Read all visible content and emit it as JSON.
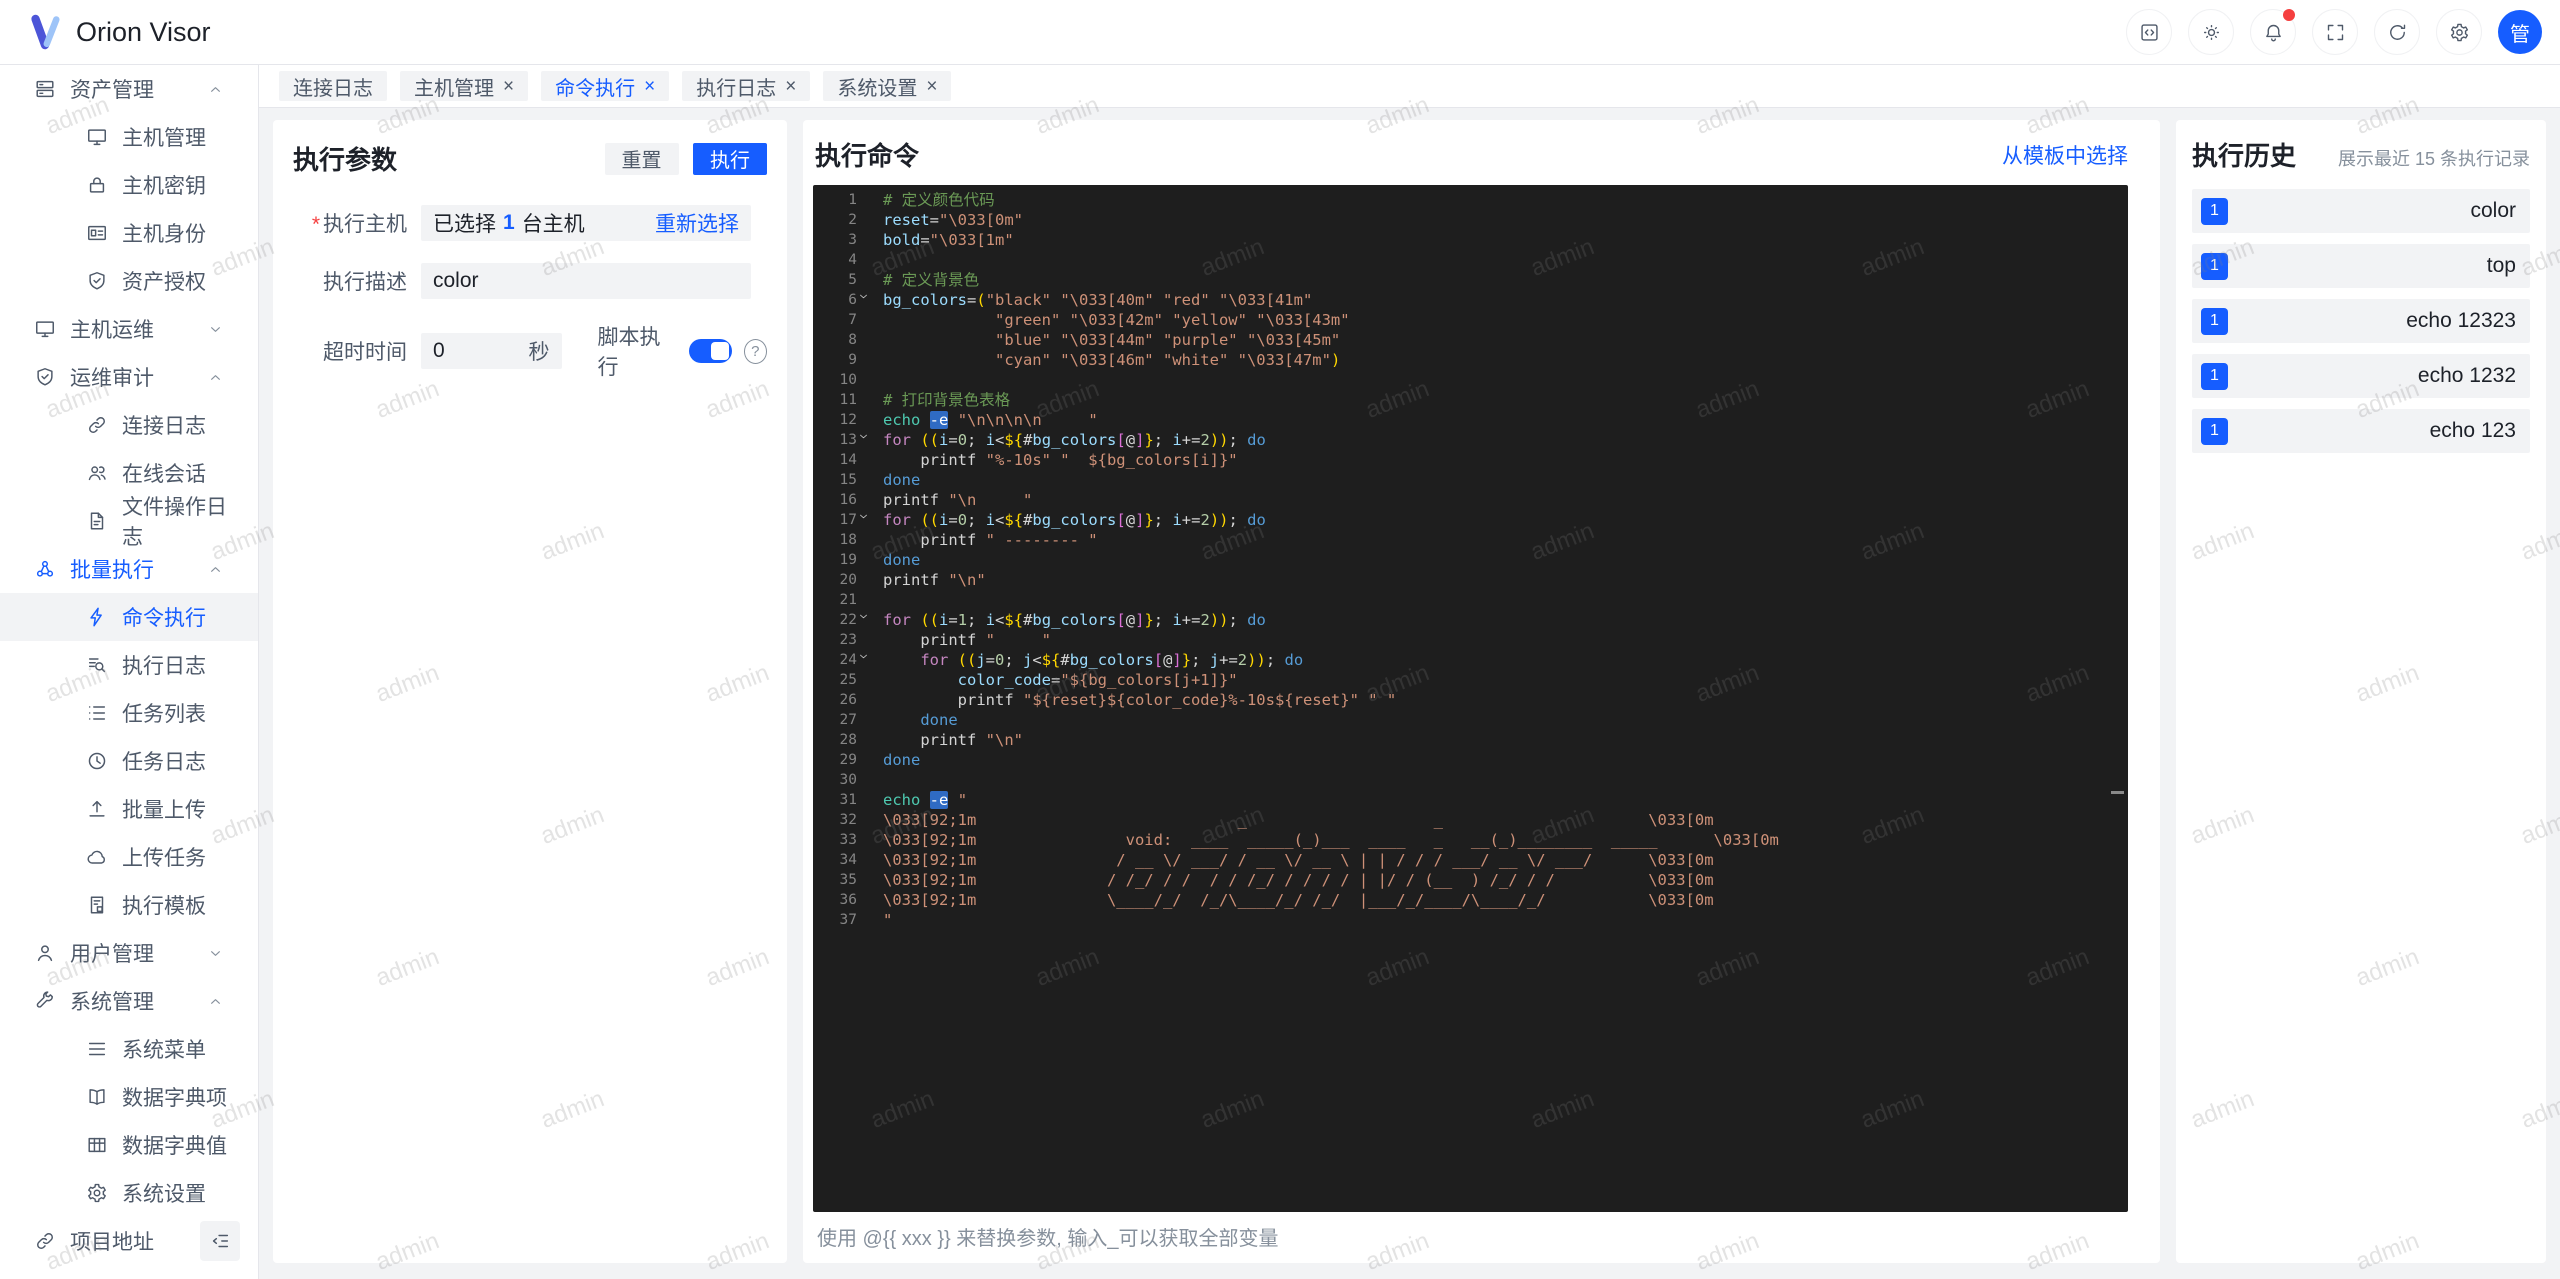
{
  "watermark": {
    "text": "admin"
  },
  "header": {
    "logo_text": "Orion Visor",
    "actions": [
      {
        "id": "code",
        "icon": "codebox"
      },
      {
        "id": "theme",
        "icon": "sun"
      },
      {
        "id": "notifications",
        "icon": "bell",
        "badge": true
      },
      {
        "id": "fullscreen",
        "icon": "fullscreen"
      },
      {
        "id": "refresh",
        "icon": "refresh"
      },
      {
        "id": "settings",
        "icon": "gear"
      }
    ],
    "avatar_text": "管"
  },
  "tabs": [
    {
      "id": "connection-log",
      "label": "连接日志",
      "closable": false,
      "active": false
    },
    {
      "id": "host-management",
      "label": "主机管理",
      "closable": true,
      "active": false
    },
    {
      "id": "command-execution",
      "label": "命令执行",
      "closable": true,
      "active": true
    },
    {
      "id": "execution-log",
      "label": "执行日志",
      "closable": true,
      "active": false
    },
    {
      "id": "system-settings",
      "label": "系统设置",
      "closable": true,
      "active": false
    }
  ],
  "sidebar": {
    "items": [
      {
        "id": "asset-management",
        "label": "资产管理",
        "icon": "server",
        "lvl": 1,
        "chev": "up"
      },
      {
        "id": "host-management",
        "label": "主机管理",
        "icon": "monitor",
        "lvl": 2
      },
      {
        "id": "host-keys",
        "label": "主机密钥",
        "icon": "lock",
        "lvl": 2
      },
      {
        "id": "host-identity",
        "label": "主机身份",
        "icon": "idcard",
        "lvl": 2
      },
      {
        "id": "asset-authorization",
        "label": "资产授权",
        "icon": "shield",
        "lvl": 2
      },
      {
        "id": "host-ops",
        "label": "主机运维",
        "icon": "monitor",
        "lvl": 1,
        "chev": "down"
      },
      {
        "id": "ops-audit",
        "label": "运维审计",
        "icon": "shield",
        "lvl": 1,
        "chev": "up"
      },
      {
        "id": "connection-log",
        "label": "连接日志",
        "icon": "link",
        "lvl": 2
      },
      {
        "id": "online-sessions",
        "label": "在线会话",
        "icon": "users",
        "lvl": 2
      },
      {
        "id": "file-operation-log",
        "label": "文件操作日志",
        "icon": "file",
        "lvl": 2
      },
      {
        "id": "batch-execution",
        "label": "批量执行",
        "icon": "cluster",
        "lvl": 1,
        "chev": "up",
        "active": true
      },
      {
        "id": "command-execution",
        "label": "命令执行",
        "icon": "bolt",
        "lvl": 2,
        "selected": true
      },
      {
        "id": "execution-log",
        "label": "执行日志",
        "icon": "filesearch",
        "lvl": 2
      },
      {
        "id": "task-list",
        "label": "任务列表",
        "icon": "list",
        "lvl": 2
      },
      {
        "id": "task-log",
        "label": "任务日志",
        "icon": "clock",
        "lvl": 2
      },
      {
        "id": "batch-upload",
        "label": "批量上传",
        "icon": "upload",
        "lvl": 2
      },
      {
        "id": "upload-tasks",
        "label": "上传任务",
        "icon": "cloud",
        "lvl": 2
      },
      {
        "id": "execution-templates",
        "label": "执行模板",
        "icon": "template",
        "lvl": 2
      },
      {
        "id": "user-management",
        "label": "用户管理",
        "icon": "user",
        "lvl": 1,
        "chev": "down"
      },
      {
        "id": "system-management",
        "label": "系统管理",
        "icon": "wrench",
        "lvl": 1,
        "chev": "up"
      },
      {
        "id": "system-menu",
        "label": "系统菜单",
        "icon": "menu",
        "lvl": 2
      },
      {
        "id": "dict-keys",
        "label": "数据字典项",
        "icon": "book",
        "lvl": 2
      },
      {
        "id": "dict-values",
        "label": "数据字典值",
        "icon": "table",
        "lvl": 2
      },
      {
        "id": "system-settings",
        "label": "系统设置",
        "icon": "gear",
        "lvl": 2
      },
      {
        "id": "project-url",
        "label": "项目地址",
        "icon": "link",
        "lvl": 1
      }
    ]
  },
  "params_panel": {
    "title": "执行参数",
    "reset_label": "重置",
    "run_label": "执行",
    "host_label": "执行主机",
    "host_prefix": "已选择",
    "host_count": "1",
    "host_suffix": "台主机",
    "reselect_label": "重新选择",
    "desc_label": "执行描述",
    "desc_value": "color",
    "timeout_label": "超时时间",
    "timeout_value": "0",
    "timeout_unit": "秒",
    "script_label": "脚本执行",
    "script_on": true
  },
  "command_panel": {
    "title": "执行命令",
    "template_link": "从模板中选择",
    "hint": "使用 @{{ xxx }} 来替换参数, 输入_可以获取全部变量",
    "code_lines": [
      {
        "t": [
          [
            "c",
            "# 定义颜色代码"
          ]
        ]
      },
      {
        "t": [
          [
            "v",
            "reset"
          ],
          [
            "w",
            "="
          ],
          [
            "s",
            "\"\\033[0m\""
          ]
        ]
      },
      {
        "t": [
          [
            "v",
            "bold"
          ],
          [
            "w",
            "="
          ],
          [
            "s",
            "\"\\033[1m\""
          ]
        ]
      },
      {
        "t": []
      },
      {
        "t": [
          [
            "c",
            "# 定义背景色"
          ]
        ]
      },
      {
        "f": 1,
        "t": [
          [
            "v",
            "bg_colors"
          ],
          [
            "w",
            "="
          ],
          [
            "g",
            "("
          ],
          [
            "s",
            "\"black\" \"\\033[40m\" \"red\" \"\\033[41m\""
          ]
        ]
      },
      {
        "t": [
          [
            "w",
            "            "
          ],
          [
            "s",
            "\"green\" \"\\033[42m\" \"yellow\" \"\\033[43m\""
          ]
        ]
      },
      {
        "t": [
          [
            "w",
            "            "
          ],
          [
            "s",
            "\"blue\" \"\\033[44m\" \"purple\" \"\\033[45m\""
          ]
        ]
      },
      {
        "t": [
          [
            "w",
            "            "
          ],
          [
            "s",
            "\"cyan\" \"\\033[46m\" \"white\" \"\\033[47m\""
          ],
          [
            "g",
            ")"
          ]
        ]
      },
      {
        "t": []
      },
      {
        "t": [
          [
            "c",
            "# 打印背景色表格"
          ]
        ]
      },
      {
        "t": [
          [
            "f2",
            "echo "
          ],
          [
            "hl",
            "-e"
          ],
          [
            "w",
            " "
          ],
          [
            "s",
            "\"\\n\\n\\n\\n     \""
          ]
        ]
      },
      {
        "f": 1,
        "t": [
          [
            "k",
            "for "
          ],
          [
            "g",
            "(("
          ],
          [
            "v",
            "i"
          ],
          [
            "w",
            "="
          ],
          [
            "n",
            "0"
          ],
          [
            "w",
            "; "
          ],
          [
            "v",
            "i"
          ],
          [
            "w",
            "<"
          ],
          [
            "g",
            "${"
          ],
          [
            "w",
            "#"
          ],
          [
            "v",
            "bg_colors"
          ],
          [
            "m",
            "["
          ],
          [
            "w",
            "@"
          ],
          [
            "m",
            "]"
          ],
          [
            "g",
            "}"
          ],
          [
            "w",
            "; "
          ],
          [
            "v",
            "i"
          ],
          [
            "w",
            "+="
          ],
          [
            "n",
            "2"
          ],
          [
            "g",
            "))"
          ],
          [
            "w",
            "; "
          ],
          [
            "d",
            "do"
          ]
        ]
      },
      {
        "t": [
          [
            "w",
            "    "
          ],
          [
            "p",
            "printf "
          ],
          [
            "s",
            "\"%-10s\" \"  ${bg_colors[i]}\""
          ]
        ]
      },
      {
        "t": [
          [
            "d",
            "done"
          ]
        ]
      },
      {
        "t": [
          [
            "p",
            "printf "
          ],
          [
            "s",
            "\"\\n     \""
          ]
        ]
      },
      {
        "f": 1,
        "t": [
          [
            "k",
            "for "
          ],
          [
            "g",
            "(("
          ],
          [
            "v",
            "i"
          ],
          [
            "w",
            "="
          ],
          [
            "n",
            "0"
          ],
          [
            "w",
            "; "
          ],
          [
            "v",
            "i"
          ],
          [
            "w",
            "<"
          ],
          [
            "g",
            "${"
          ],
          [
            "w",
            "#"
          ],
          [
            "v",
            "bg_colors"
          ],
          [
            "m",
            "["
          ],
          [
            "w",
            "@"
          ],
          [
            "m",
            "]"
          ],
          [
            "g",
            "}"
          ],
          [
            "w",
            "; "
          ],
          [
            "v",
            "i"
          ],
          [
            "w",
            "+="
          ],
          [
            "n",
            "2"
          ],
          [
            "g",
            "))"
          ],
          [
            "w",
            "; "
          ],
          [
            "d",
            "do"
          ]
        ]
      },
      {
        "t": [
          [
            "w",
            "    "
          ],
          [
            "p",
            "printf "
          ],
          [
            "s",
            "\" -------- \""
          ]
        ]
      },
      {
        "t": [
          [
            "d",
            "done"
          ]
        ]
      },
      {
        "t": [
          [
            "p",
            "printf "
          ],
          [
            "s",
            "\"\\n\""
          ]
        ]
      },
      {
        "t": []
      },
      {
        "f": 1,
        "t": [
          [
            "k",
            "for "
          ],
          [
            "g",
            "(("
          ],
          [
            "v",
            "i"
          ],
          [
            "w",
            "="
          ],
          [
            "n",
            "1"
          ],
          [
            "w",
            "; "
          ],
          [
            "v",
            "i"
          ],
          [
            "w",
            "<"
          ],
          [
            "g",
            "${"
          ],
          [
            "w",
            "#"
          ],
          [
            "v",
            "bg_colors"
          ],
          [
            "m",
            "["
          ],
          [
            "w",
            "@"
          ],
          [
            "m",
            "]"
          ],
          [
            "g",
            "}"
          ],
          [
            "w",
            "; "
          ],
          [
            "v",
            "i"
          ],
          [
            "w",
            "+="
          ],
          [
            "n",
            "2"
          ],
          [
            "g",
            "))"
          ],
          [
            "w",
            "; "
          ],
          [
            "d",
            "do"
          ]
        ]
      },
      {
        "t": [
          [
            "w",
            "    "
          ],
          [
            "p",
            "printf "
          ],
          [
            "s",
            "\"     \""
          ]
        ]
      },
      {
        "f": 1,
        "t": [
          [
            "w",
            "    "
          ],
          [
            "k",
            "for "
          ],
          [
            "g",
            "(("
          ],
          [
            "v",
            "j"
          ],
          [
            "w",
            "="
          ],
          [
            "n",
            "0"
          ],
          [
            "w",
            "; "
          ],
          [
            "v",
            "j"
          ],
          [
            "w",
            "<"
          ],
          [
            "g",
            "${"
          ],
          [
            "w",
            "#"
          ],
          [
            "v",
            "bg_colors"
          ],
          [
            "m",
            "["
          ],
          [
            "w",
            "@"
          ],
          [
            "m",
            "]"
          ],
          [
            "g",
            "}"
          ],
          [
            "w",
            "; "
          ],
          [
            "v",
            "j"
          ],
          [
            "w",
            "+="
          ],
          [
            "n",
            "2"
          ],
          [
            "g",
            "))"
          ],
          [
            "w",
            "; "
          ],
          [
            "d",
            "do"
          ]
        ]
      },
      {
        "t": [
          [
            "w",
            "        "
          ],
          [
            "v",
            "color_code"
          ],
          [
            "w",
            "="
          ],
          [
            "s",
            "\"${bg_colors[j+1]}\""
          ]
        ]
      },
      {
        "t": [
          [
            "w",
            "        "
          ],
          [
            "p",
            "printf "
          ],
          [
            "s",
            "\"${reset}${color_code}%-10s${reset}\" \" \""
          ]
        ]
      },
      {
        "t": [
          [
            "w",
            "    "
          ],
          [
            "d",
            "done"
          ]
        ]
      },
      {
        "t": [
          [
            "w",
            "    "
          ],
          [
            "p",
            "printf "
          ],
          [
            "s",
            "\"\\n\""
          ]
        ]
      },
      {
        "t": [
          [
            "d",
            "done"
          ]
        ]
      },
      {
        "t": []
      },
      {
        "t": [
          [
            "f2",
            "echo "
          ],
          [
            "hl",
            "-e"
          ],
          [
            "w",
            " "
          ],
          [
            "s",
            "\""
          ]
        ]
      },
      {
        "t": [
          [
            "s",
            "\\033[92;1m                            _                    _                      \\033[0m"
          ]
        ]
      },
      {
        "t": [
          [
            "s",
            "\\033[92;1m                void:  ____  _____(_)___  ____   _   __(_)________  _____      \\033[0m"
          ]
        ]
      },
      {
        "t": [
          [
            "s",
            "\\033[92;1m               / __ \\/ ___/ / __ \\/ __ \\ | | / / / ___/ __ \\/ ___/      \\033[0m"
          ]
        ]
      },
      {
        "t": [
          [
            "s",
            "\\033[92;1m              / /_/ / /  / / /_/ / / / / | |/ / (__  ) /_/ / /          \\033[0m"
          ]
        ]
      },
      {
        "t": [
          [
            "s",
            "\\033[92;1m              \\____/_/  /_/\\____/_/ /_/  |___/_/____/\\____/_/           \\033[0m"
          ]
        ]
      },
      {
        "t": [
          [
            "s",
            "\""
          ]
        ]
      }
    ]
  },
  "history_panel": {
    "title": "执行历史",
    "subtitle": "展示最近 15 条执行记录",
    "items": [
      {
        "count": "1",
        "name": "color"
      },
      {
        "count": "1",
        "name": "top"
      },
      {
        "count": "1",
        "name": "echo 12323"
      },
      {
        "count": "1",
        "name": "echo 1232"
      },
      {
        "count": "1",
        "name": "echo 123"
      }
    ]
  },
  "colors": {
    "primary": "#165dff",
    "danger": "#f53f3f",
    "editor_bg": "#1e1e1e",
    "content_bg": "#f2f3f5"
  }
}
